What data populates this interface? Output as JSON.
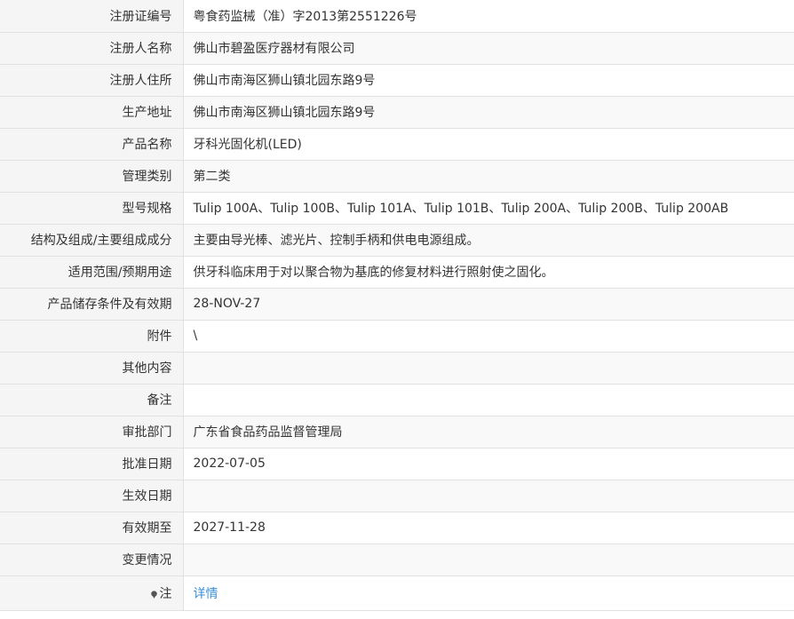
{
  "rows": [
    {
      "label": "注册证编号",
      "value": "粤食药监械（准）字2013第2551226号"
    },
    {
      "label": "注册人名称",
      "value": "佛山市碧盈医疗器材有限公司"
    },
    {
      "label": "注册人住所",
      "value": "佛山市南海区狮山镇北园东路9号"
    },
    {
      "label": "生产地址",
      "value": "佛山市南海区狮山镇北园东路9号"
    },
    {
      "label": "产品名称",
      "value": "牙科光固化机(LED)"
    },
    {
      "label": "管理类别",
      "value": "第二类"
    },
    {
      "label": "型号规格",
      "value": "Tulip 100A、Tulip 100B、Tulip 101A、Tulip 101B、Tulip 200A、Tulip 200B、Tulip 200AB"
    },
    {
      "label": "结构及组成/主要组成成分",
      "value": "主要由导光棒、滤光片、控制手柄和供电电源组成。"
    },
    {
      "label": "适用范围/预期用途",
      "value": "供牙科临床用于对以聚合物为基底的修复材料进行照射使之固化。"
    },
    {
      "label": "产品储存条件及有效期",
      "value": "28-NOV-27"
    },
    {
      "label": "附件",
      "value": "\\"
    },
    {
      "label": "其他内容",
      "value": ""
    },
    {
      "label": "备注",
      "value": ""
    },
    {
      "label": "审批部门",
      "value": "广东省食品药品监督管理局"
    },
    {
      "label": "批准日期",
      "value": "2022-07-05"
    },
    {
      "label": "生效日期",
      "value": ""
    },
    {
      "label": "有效期至",
      "value": "2027-11-28"
    },
    {
      "label": "变更情况",
      "value": ""
    }
  ],
  "note": {
    "icon": "pin-icon",
    "label": "注",
    "link_text": "详情"
  },
  "colors": {
    "label_bg": "#f5f5f5",
    "border": "#e1e1e1",
    "link": "#3b8fd6",
    "text": "#333333"
  }
}
